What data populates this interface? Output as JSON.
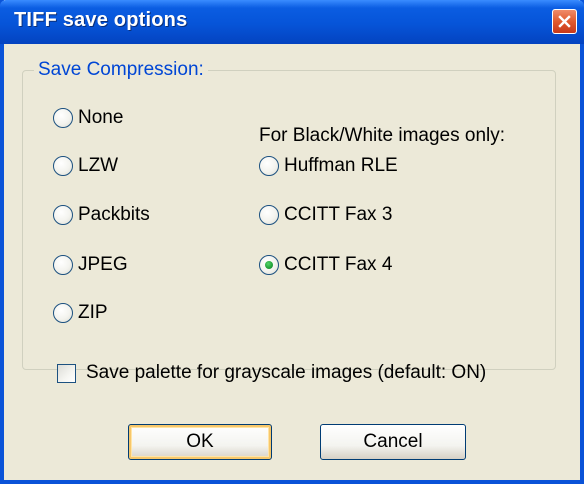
{
  "window": {
    "title": "TIFF save options",
    "close_icon": "close-icon"
  },
  "group": {
    "label": "Save Compression:",
    "bw_label": "For Black/White images only:"
  },
  "radios": {
    "none": "None",
    "lzw": "LZW",
    "packbits": "Packbits",
    "jpeg": "JPEG",
    "zip": "ZIP",
    "huffman": "Huffman RLE",
    "fax3": "CCITT Fax 3",
    "fax4": "CCITT Fax 4",
    "selected": "CCITT Fax 4"
  },
  "checkbox": {
    "label": "Save palette for grayscale images (default: ON)",
    "checked": false
  },
  "buttons": {
    "ok": "OK",
    "cancel": "Cancel"
  },
  "colors": {
    "titlebar": "#0654D8",
    "dialog_bg": "#ECE9D8",
    "group_label": "#0046D5",
    "selected_dot": "#21A137",
    "close_button": "#E05A2E"
  }
}
